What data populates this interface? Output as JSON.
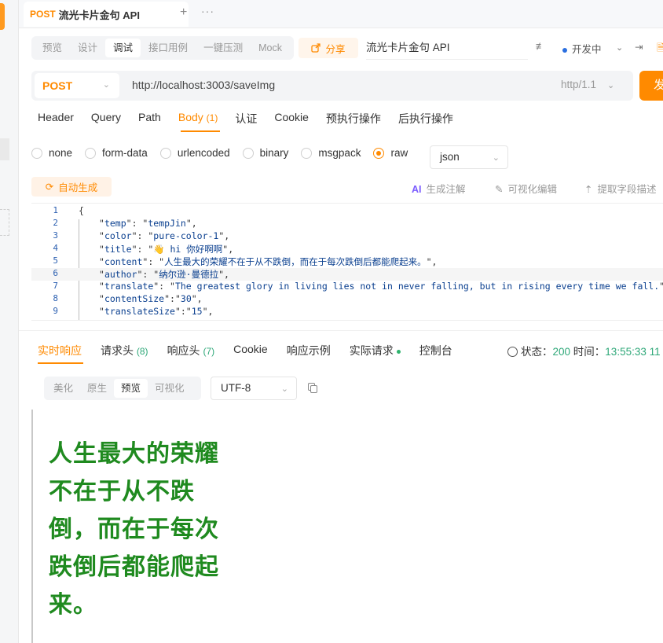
{
  "tab": {
    "method": "POST",
    "title": "流光卡片金句 API",
    "plus": "+",
    "more": "···"
  },
  "modes": [
    "预览",
    "设计",
    "调试",
    "接口用例",
    "一键压测",
    "Mock"
  ],
  "active_mode": "调试",
  "share_label": "分享",
  "api_name": "流光卡片金句 API",
  "dev_status": "开发中",
  "request": {
    "method": "POST",
    "url": "http://localhost:3003/saveImg",
    "http_version": "http/1.1",
    "send_label": "发送"
  },
  "req_tabs": [
    {
      "label": "Header",
      "count": ""
    },
    {
      "label": "Query",
      "count": ""
    },
    {
      "label": "Path",
      "count": ""
    },
    {
      "label": "Body",
      "count": "(1)"
    },
    {
      "label": "认证",
      "count": ""
    },
    {
      "label": "Cookie",
      "count": ""
    },
    {
      "label": "预执行操作",
      "count": ""
    },
    {
      "label": "后执行操作",
      "count": ""
    }
  ],
  "body_types": [
    "none",
    "form-data",
    "urlencoded",
    "binary",
    "msgpack",
    "raw"
  ],
  "body_type_selected": "raw",
  "body_format": "json",
  "actions": {
    "autogen": "自动生成",
    "ai_label": "AI",
    "gen_comment": "生成注解",
    "visual_edit": "可视化编辑",
    "extract_desc": "提取字段描述"
  },
  "code_lines": [
    {
      "n": "1",
      "text": "{"
    },
    {
      "n": "2",
      "key": "temp",
      "val": "tempJin"
    },
    {
      "n": "3",
      "key": "color",
      "val": "pure-color-1"
    },
    {
      "n": "4",
      "key": "title",
      "val": "👋 hi 你好啊啊"
    },
    {
      "n": "5",
      "key": "content",
      "val": "人生最大的荣耀不在于从不跌倒，而在于每次跌倒后都能爬起来。"
    },
    {
      "n": "6",
      "key": "author",
      "val": "纳尔逊·曼德拉"
    },
    {
      "n": "7",
      "key": "translate",
      "val": "The greatest glory in living lies not in never falling, but in rising every time we fall."
    },
    {
      "n": "8",
      "key": "contentSize",
      "val": "30",
      "tight": true
    },
    {
      "n": "9",
      "key": "translateSize",
      "val": "15",
      "tight": true
    }
  ],
  "resp_tabs": [
    {
      "label": "实时响应",
      "count": ""
    },
    {
      "label": "请求头",
      "count": "(8)"
    },
    {
      "label": "响应头",
      "count": "(7)"
    },
    {
      "label": "Cookie",
      "count": ""
    },
    {
      "label": "响应示例",
      "count": ""
    },
    {
      "label": "实际请求",
      "count": ""
    },
    {
      "label": "控制台",
      "count": ""
    }
  ],
  "resp_status": {
    "status_label": "状态：",
    "status": "200",
    "time_label": "时间：",
    "time": "13:55:33",
    "extra": "11"
  },
  "views": [
    "美化",
    "原生",
    "预览",
    "可视化"
  ],
  "active_view": "预览",
  "encoding": "UTF-8",
  "preview_lines": [
    "人生最大的荣耀",
    "不在于从不跌",
    "倒，而在于每次",
    "跌倒后都能爬起",
    "来。"
  ],
  "colors": {
    "accent": "#ff8a00",
    "success": "#2fa879",
    "preview_text": "#1f8a1f"
  }
}
